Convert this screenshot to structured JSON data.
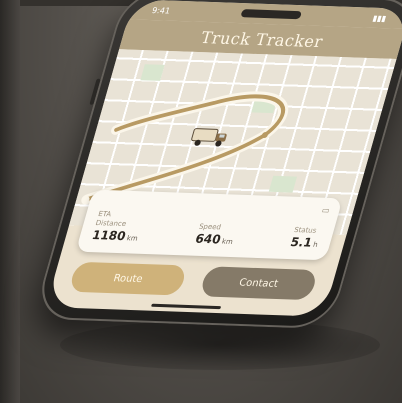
{
  "app": {
    "title": "Truck Tracker"
  },
  "status_bar": {
    "time": "9:41"
  },
  "stats": [
    {
      "label": "ETA\nDistance",
      "value": "1180",
      "unit": "km"
    },
    {
      "label": "Speed",
      "value": "640",
      "unit": "km"
    },
    {
      "label": "Status",
      "value": "5.1",
      "unit": "h"
    }
  ],
  "buttons": {
    "primary": "Route",
    "secondary": "Contact"
  },
  "colors": {
    "accent": "#cfb27a",
    "header": "#b5a585",
    "secondary": "#857a68"
  },
  "icons": {
    "truck": "truck-icon",
    "battery": "battery-icon",
    "signal": "signal-icon",
    "pin": "map-pin-icon"
  }
}
